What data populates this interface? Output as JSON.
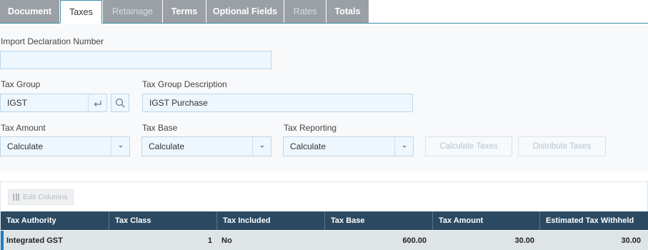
{
  "tabs": [
    {
      "label": "Document",
      "state": "normal"
    },
    {
      "label": "Taxes",
      "state": "active"
    },
    {
      "label": "Retainage",
      "state": "disabled"
    },
    {
      "label": "Terms",
      "state": "normal"
    },
    {
      "label": "Optional Fields",
      "state": "normal"
    },
    {
      "label": "Rates",
      "state": "disabled"
    },
    {
      "label": "Totals",
      "state": "normal"
    }
  ],
  "form": {
    "import_declaration_label": "Import Declaration Number",
    "import_declaration_value": "",
    "tax_group_label": "Tax Group",
    "tax_group_value": "IGST",
    "tax_group_desc_label": "Tax Group Description",
    "tax_group_desc_value": "IGST Purchase",
    "tax_amount_label": "Tax Amount",
    "tax_amount_value": "Calculate",
    "tax_base_label": "Tax Base",
    "tax_base_value": "Calculate",
    "tax_reporting_label": "Tax Reporting",
    "tax_reporting_value": "Calculate",
    "calculate_taxes_label": "Calculate Taxes",
    "distribute_taxes_label": "Distribute Taxes"
  },
  "grid": {
    "edit_columns_label": "Edit Columns",
    "columns": [
      "Tax Authority",
      "Tax Class",
      "Tax Included",
      "Tax Base",
      "Tax Amount",
      "Estimated Tax Withheld"
    ],
    "rows": [
      {
        "tax_authority": "Integrated GST",
        "tax_class": "1",
        "tax_included": "No",
        "tax_base": "600.00",
        "tax_amount": "30.00",
        "estimated_tax_withheld": "30.00"
      }
    ]
  },
  "colors": {
    "grid_header": "#2b4a62",
    "tab_inactive": "#9aa0a6",
    "accent": "#1f7fc0",
    "input_bg": "#eef7fd"
  }
}
